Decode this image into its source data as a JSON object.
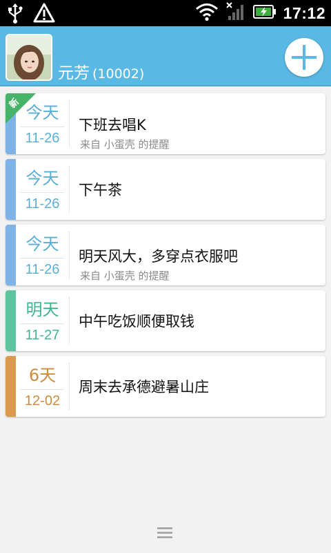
{
  "status_bar": {
    "time": "17:12",
    "icons": [
      "usb-icon",
      "warning-icon",
      "wifi-icon",
      "signal-icon",
      "battery-charging-icon"
    ]
  },
  "header": {
    "user_name": "元芳",
    "user_id": "(10002)",
    "add_button": "add-icon"
  },
  "reminders": [
    {
      "day": "今天",
      "date": "11-26",
      "title": "下班去唱K",
      "subtitle": "来自 小蛋壳 的提醒",
      "new_badge": "新",
      "color": "#7fb2e5"
    },
    {
      "day": "今天",
      "date": "11-26",
      "title": "下午茶",
      "subtitle": "",
      "color": "#7fb2e5"
    },
    {
      "day": "今天",
      "date": "11-26",
      "title": "明天风大，多穿点衣服吧",
      "subtitle": "来自 小蛋壳 的提醒",
      "color": "#7fb2e5"
    },
    {
      "day": "明天",
      "date": "11-27",
      "title": "中午吃饭顺便取钱",
      "subtitle": "",
      "color": "#5dc4a0"
    },
    {
      "day": "6天",
      "date": "12-02",
      "title": "周末去承德避暑山庄",
      "subtitle": "",
      "color": "#d99a4e"
    }
  ],
  "colors": {
    "header_bg": "#5ab8e4",
    "today_text": "#5aaed6",
    "tomorrow_text": "#42b58c",
    "later_text": "#cf8a3a"
  },
  "bottom_bar": {
    "menu": "menu-icon"
  }
}
